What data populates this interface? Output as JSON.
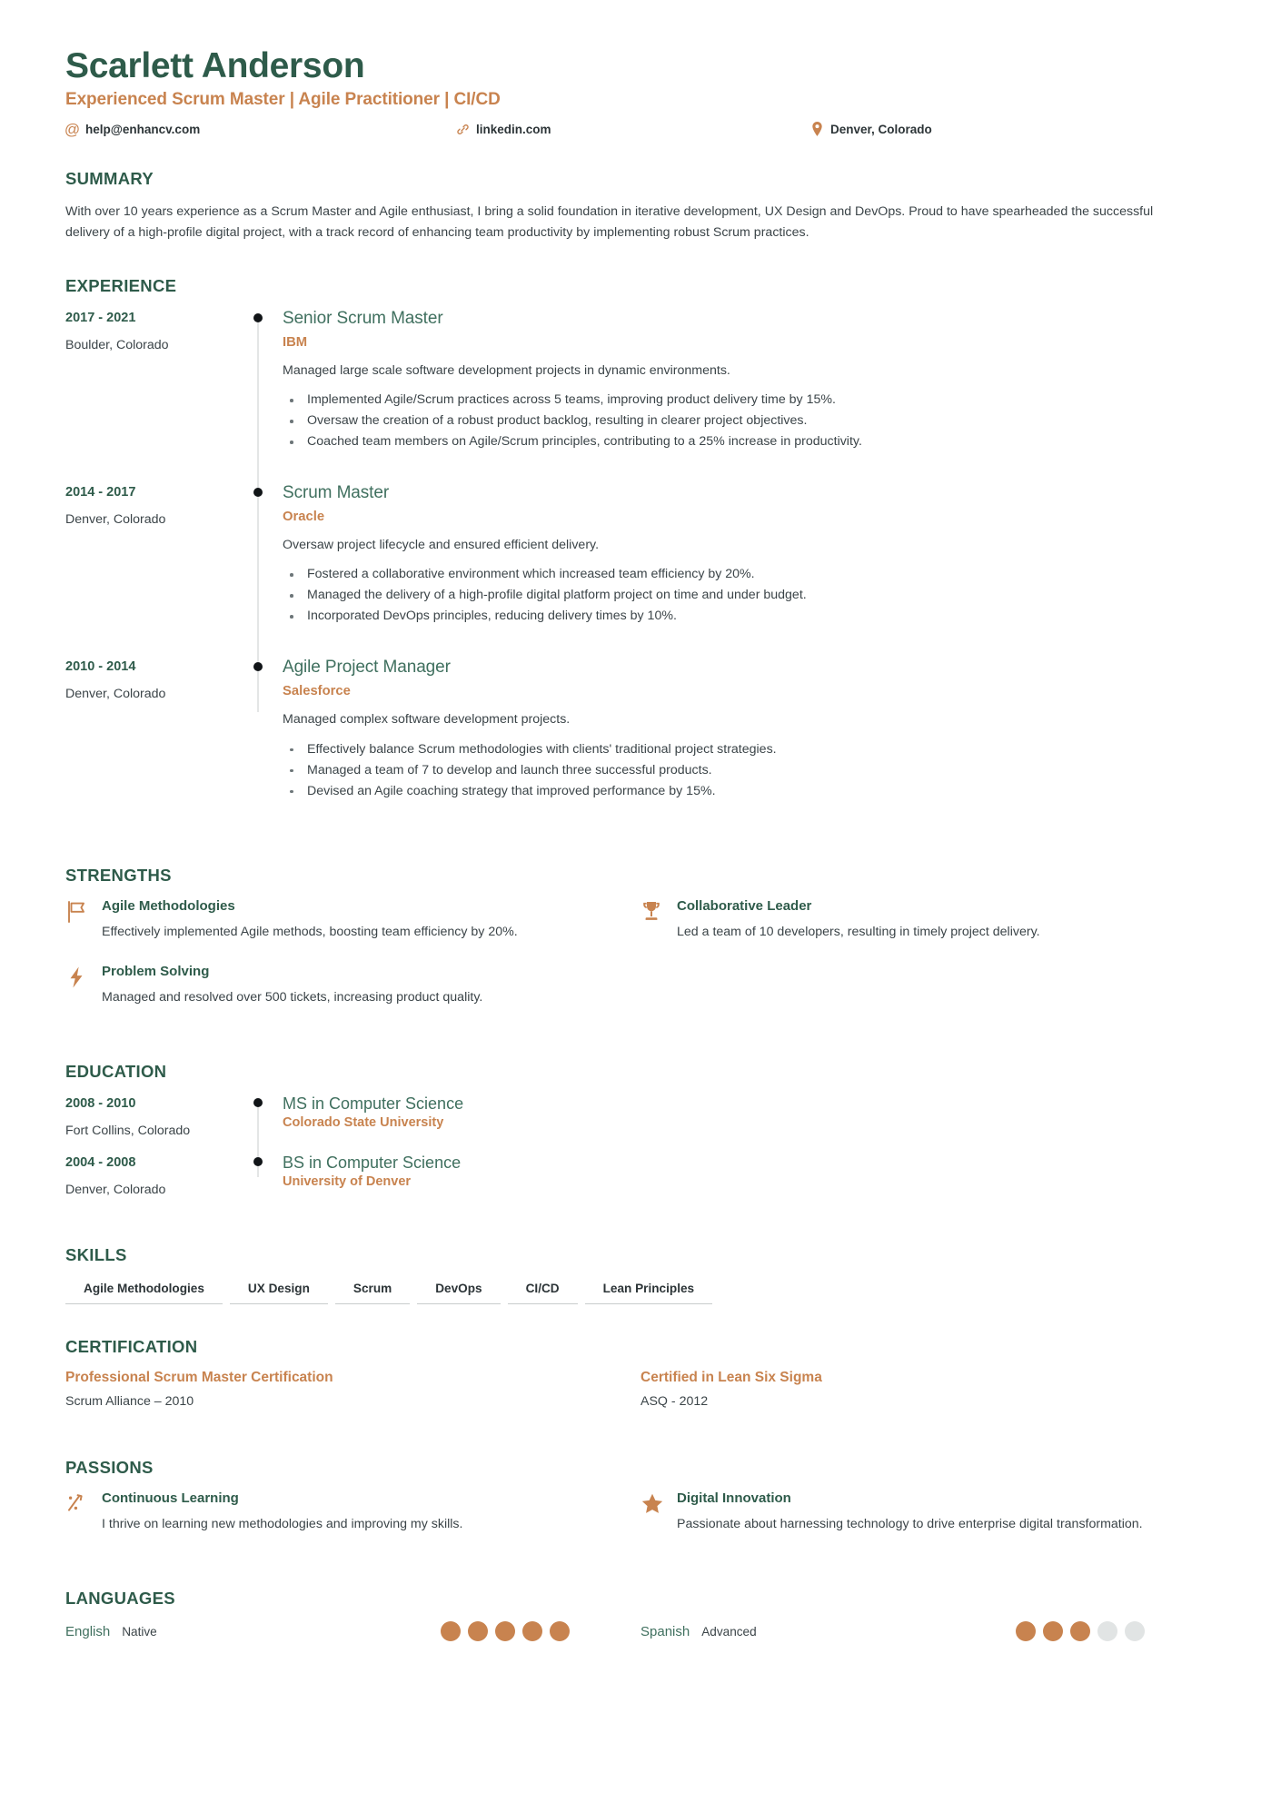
{
  "header": {
    "name": "Scarlett Anderson",
    "headline": "Experienced Scrum Master | Agile Practitioner | CI/CD",
    "contacts": [
      {
        "icon": "at-icon",
        "text": "help@enhancv.com"
      },
      {
        "icon": "link-icon",
        "text": "linkedin.com"
      },
      {
        "icon": "location-pin-icon",
        "text": "Denver, Colorado"
      }
    ]
  },
  "summary": {
    "title": "SUMMARY",
    "text": "With over 10 years experience as a Scrum Master and Agile enthusiast, I bring a solid foundation in iterative development, UX Design and DevOps. Proud to have spearheaded the successful delivery of a high-profile digital project, with a track record of enhancing team productivity by implementing robust Scrum practices."
  },
  "experience": {
    "title": "EXPERIENCE",
    "items": [
      {
        "dates": "2017 - 2021",
        "location": "Boulder, Colorado",
        "role": "Senior Scrum Master",
        "company": "IBM",
        "description": "Managed large scale software development projects in dynamic environments.",
        "bullets": [
          "Implemented Agile/Scrum practices across 5 teams, improving product delivery time by 15%.",
          "Oversaw the creation of a robust product backlog, resulting in clearer project objectives.",
          "Coached team members on Agile/Scrum principles, contributing to a 25% increase in productivity."
        ]
      },
      {
        "dates": "2014 - 2017",
        "location": "Denver, Colorado",
        "role": "Scrum Master",
        "company": "Oracle",
        "description": "Oversaw project lifecycle and ensured efficient delivery.",
        "bullets": [
          "Fostered a collaborative environment which increased team efficiency by 20%.",
          "Managed the delivery of a high-profile digital platform project on time and under budget.",
          "Incorporated DevOps principles, reducing delivery times by 10%."
        ]
      },
      {
        "dates": "2010 - 2014",
        "location": "Denver, Colorado",
        "role": "Agile Project Manager",
        "company": "Salesforce",
        "description": "Managed complex software development projects.",
        "bullets": [
          "Effectively balance Scrum methodologies with clients' traditional project strategies.",
          "Managed a team of 7 to develop and launch three successful products.",
          "Devised an Agile coaching strategy that improved performance by 15%."
        ]
      }
    ]
  },
  "strengths": {
    "title": "STRENGTHS",
    "items": [
      {
        "icon": "flag-icon",
        "heading": "Agile Methodologies",
        "description": "Effectively implemented Agile methods, boosting team efficiency by 20%."
      },
      {
        "icon": "trophy-icon",
        "heading": "Collaborative Leader",
        "description": "Led a team of 10 developers, resulting in timely project delivery."
      },
      {
        "icon": "lightning-bolt-icon",
        "heading": "Problem Solving",
        "description": "Managed and resolved over 500 tickets, increasing product quality."
      }
    ]
  },
  "education": {
    "title": "EDUCATION",
    "items": [
      {
        "dates": "2008 - 2010",
        "location": "Fort Collins, Colorado",
        "degree": "MS in Computer Science",
        "school": "Colorado State University"
      },
      {
        "dates": "2004 - 2008",
        "location": "Denver, Colorado",
        "degree": "BS in Computer Science",
        "school": "University of Denver"
      }
    ]
  },
  "skills": {
    "title": "SKILLS",
    "items": [
      "Agile Methodologies",
      "UX Design",
      "Scrum",
      "DevOps",
      "CI/CD",
      "Lean Principles"
    ]
  },
  "certification": {
    "title": "CERTIFICATION",
    "items": [
      {
        "name": "Professional Scrum Master Certification",
        "issuer": "Scrum Alliance – 2010"
      },
      {
        "name": "Certified in Lean Six Sigma",
        "issuer": "ASQ - 2012"
      }
    ]
  },
  "passions": {
    "title": "PASSIONS",
    "items": [
      {
        "icon": "growth-percent-icon",
        "heading": "Continuous Learning",
        "description": "I thrive on learning new methodologies and improving my skills."
      },
      {
        "icon": "star-icon",
        "heading": "Digital Innovation",
        "description": "Passionate about harnessing technology to drive enterprise digital transformation."
      }
    ]
  },
  "languages": {
    "title": "LANGUAGES",
    "items": [
      {
        "name": "English",
        "level": "Native",
        "filled": 5,
        "total": 5
      },
      {
        "name": "Spanish",
        "level": "Advanced",
        "filled": 3,
        "total": 5
      }
    ]
  },
  "colors": {
    "green": "#2e5b4a",
    "green_light": "#40705f",
    "accent_orange": "#c8834f",
    "body_text": "#3b4448",
    "dot_empty": "#e1e4e4",
    "rule": "#c9cdcd"
  }
}
